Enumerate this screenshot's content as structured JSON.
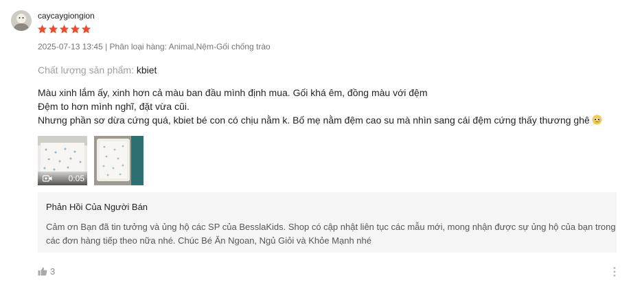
{
  "review": {
    "username": "caycaygiongion",
    "rating": 5,
    "meta": "2025-07-13 13:45 | Phân loại hàng: Animal,Nệm-Gối chống trào",
    "quality_label": "Chất lượng sản phẩm:",
    "quality_value": "kbiet",
    "content_lines": [
      "Màu xinh lắm ấy, xinh hơn cả màu ban đầu mình định mua. Gối khá êm, đồng màu với đệm",
      "Đệm to hơn mình nghĩ, đặt vừa cũi.",
      "Nhưng phần sơ dừa cứng quá, kbiet bé con có chịu nằm k. Bố mẹ nằm đệm cao su mà nhìn sang cái đệm cứng thấy thương ghê"
    ],
    "emoji_icon": "pleading-face-icon",
    "video_duration": "0:05",
    "likes": "3"
  },
  "seller_reply": {
    "title": "Phản Hồi Của Người Bán",
    "text": "Cảm ơn Bạn đã tin tưởng và ủng hộ các SP của BesslaKids. Shop có cập nhật liên tục các mẫu mới, mong nhận được sự ủng hộ của bạn trong các đơn hàng tiếp theo nữa nhé. Chúc Bé Ăn Ngoan, Ngủ Giỏi và Khỏe Mạnh nhé"
  },
  "colors": {
    "star": "#ee4d2d",
    "reply_bg": "#f5f5f5",
    "muted_text": "#757575"
  }
}
